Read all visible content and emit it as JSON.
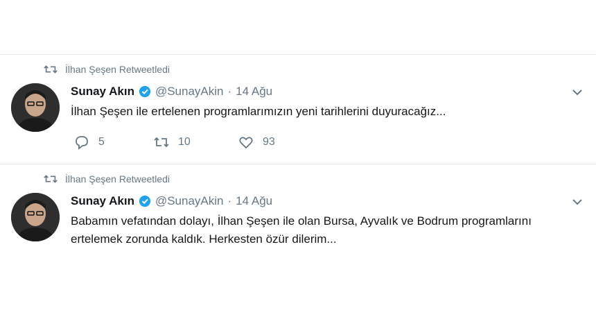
{
  "tweets": [
    {
      "retweeted_by": "İlhan Şeşen Retweetledi",
      "author_name": "Sunay Akın",
      "handle": "@SunayAkin",
      "separator": "·",
      "date": "14 Ağu",
      "text": "İlhan Şeşen ile ertelenen programlarımızın yeni tarihlerini duyuracağız...",
      "replies": "5",
      "retweets": "10",
      "likes": "93"
    },
    {
      "retweeted_by": "İlhan Şeşen Retweetledi",
      "author_name": "Sunay Akın",
      "handle": "@SunayAkin",
      "separator": "·",
      "date": "14 Ağu",
      "text": "Babamın vefatından dolayı, İlhan Şeşen ile olan Bursa, Ayvalık ve Bodrum programlarını ertelemek zorunda kaldık. Herkesten özür dilerim..."
    }
  ],
  "icons": {
    "retweet_label_icon": "retweet-icon",
    "verified_badge": "verified-badge-icon",
    "more_menu": "chevron-down-icon",
    "reply": "reply-icon",
    "retweet": "retweet-icon",
    "like": "heart-icon"
  },
  "colors": {
    "text_primary": "#14171a",
    "text_secondary": "#657786",
    "verified_blue": "#1da1f2",
    "divider": "#e6ecf0"
  }
}
